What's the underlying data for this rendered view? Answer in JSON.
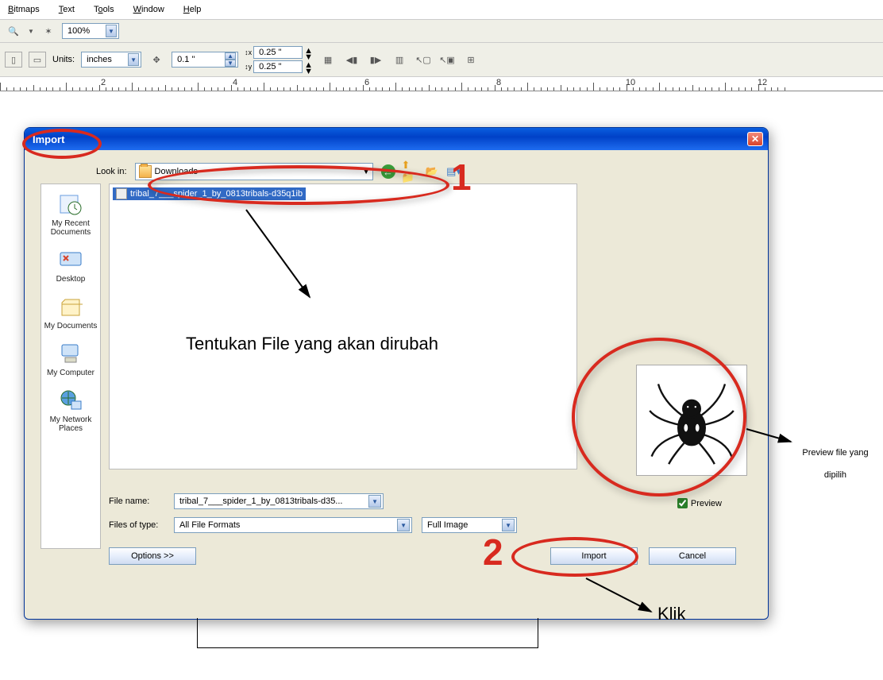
{
  "menu": {
    "bitmaps": "Bitmaps",
    "text": "Text",
    "tools": "Tools",
    "window": "Window",
    "help": "Help"
  },
  "toolbar": {
    "zoom": "100%"
  },
  "props": {
    "units_label": "Units:",
    "units_value": "inches",
    "nudge": "0.1 \"",
    "dx": "0.25 \"",
    "dy": "0.25 \""
  },
  "ruler": {
    "labels": [
      "2",
      "4",
      "6",
      "8",
      "10",
      "12"
    ]
  },
  "dialog": {
    "title": "Import",
    "lookin_label": "Look in:",
    "lookin_value": "Downloads",
    "places": [
      {
        "label": "My Recent Documents",
        "icon": "recent"
      },
      {
        "label": "Desktop",
        "icon": "desktop"
      },
      {
        "label": "My Documents",
        "icon": "mydocs"
      },
      {
        "label": "My Computer",
        "icon": "mycomputer"
      },
      {
        "label": "My Network Places",
        "icon": "network"
      }
    ],
    "file_selected": "tribal_7___spider_1_by_0813tribals-d35q1ib",
    "filename_label": "File name:",
    "filename_value": "tribal_7___spider_1_by_0813tribals-d35...",
    "filetype_label": "Files of type:",
    "filetype_value": "All File Formats",
    "imgmode": "Full Image",
    "preview_label": "Preview",
    "options_btn": "Options >>",
    "import_btn": "Import",
    "cancel_btn": "Cancel"
  },
  "annotations": {
    "main_text": "Tentukan File yang akan dirubah",
    "right_text": "Preview file yang dipilih",
    "klik": "Klik",
    "n1": "1",
    "n2": "2"
  }
}
